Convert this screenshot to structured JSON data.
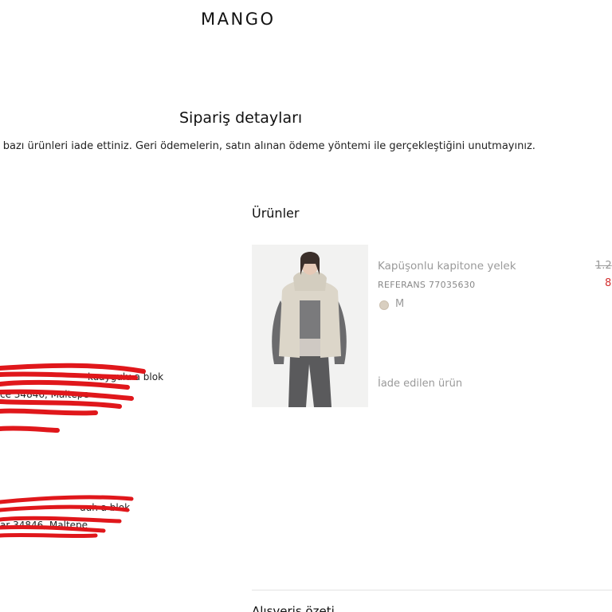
{
  "header": {
    "logo": "MANGO"
  },
  "page": {
    "title": "Sipariş detayları",
    "notice": "i bazı ürünleri iade ettiniz. Geri ödemelerin, satın alınan ödeme yöntemi ile gerçekleştiğini unutmayınız."
  },
  "products": {
    "section_title": "Ürünler",
    "item": {
      "name": "Kapüşonlu kapitone yelek",
      "reference": "REFERANS 77035630",
      "color": "#d9cfc0",
      "size": "M",
      "status": "İade edilen ürün",
      "price_old": "1.2",
      "price_new": "8"
    }
  },
  "addresses": {
    "shipping_line1": "kuaygulu a blok",
    "shipping_line2": "ce 34846, Maltepe",
    "billing_line1": "uuh a blok",
    "billing_line2": "ar 34846, Maltepe"
  },
  "summary": {
    "title": "Alışveriş özeti"
  },
  "colors": {
    "accent_red": "#d32f2f",
    "muted_text": "#9a9a9a",
    "redaction": "#e0171b"
  }
}
